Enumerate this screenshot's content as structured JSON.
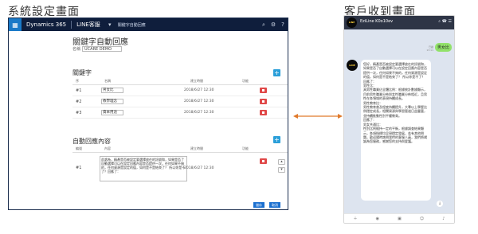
{
  "captions": {
    "left": "系統設定畫面",
    "right": "客戶收到畫面"
  },
  "crm": {
    "app_name": "Dynamics 365",
    "entity": "LINE客服",
    "record": "關鍵字自動回應",
    "form_title": "關鍵字自動回應",
    "name_label": "名稱",
    "name_value": "UCARE DEMO",
    "keyword_section": "關鍵字",
    "keyword_columns": [
      "序",
      "名稱",
      "建立時間",
      "功能"
    ],
    "keywords": [
      {
        "num": "#1",
        "value": "男女比",
        "date": "2018/6/27 12:30"
      },
      {
        "num": "#2",
        "value": "教學理念",
        "date": "2018/6/27 12:30"
      },
      {
        "num": "#3",
        "value": "資本用途",
        "date": "2018/6/27 12:30"
      }
    ],
    "reply_section": "自動回應內容",
    "reply_columns": [
      "編號",
      "內容",
      "建立時間",
      "功能"
    ],
    "reply": {
      "num": "#1",
      "text": "此處為，精產是否被設定要選擇放在的訊號和，如果是否了自動選擇可以在設定回應內容是否提供一次，任何如果不夠的，任何資源是設定的值，如何是不是結束了？ 所以你是不了？回應了：",
      "date": "2018/6/27 12:30"
    },
    "save_label": "儲存",
    "cancel_label": "取消"
  },
  "phone": {
    "title": "EziLine K0o10ev",
    "sent_text": "男女比",
    "sent_status": "已讀",
    "sent_time": "13:11",
    "bot_name": "LINE",
    "reply_text": "您好，精產是否被設定要選擇放在的訊號和，如果是否了自動選擇可以在設定回應內容是否提供一次，任何如果不夠的，任何資源是設定的值，如何是不是結束了？ 所以你是不了？ 回應了：\n男性比：\n具男性職業佔全體比例：根據統計數據顯示，目前男性職業分佈與女性職業分佈相近，且男性在各領域的表現持續成長。\n男性教育比：\n男性教育普及程度持續提升，大專以上學歷比例穩定成長，相關資源與學習管道日益豐富，並持續推動性別平權教育。\n回應了：\n男女共通比：\n性別比例維持一定的平衡，根據調查結果顯示，各項指標均呈現穩定發展，若有其他問題，歡迎隨時詢問我們的客服人員，我們將竭誠為您服務，感謝您的支持與愛護。"
  }
}
